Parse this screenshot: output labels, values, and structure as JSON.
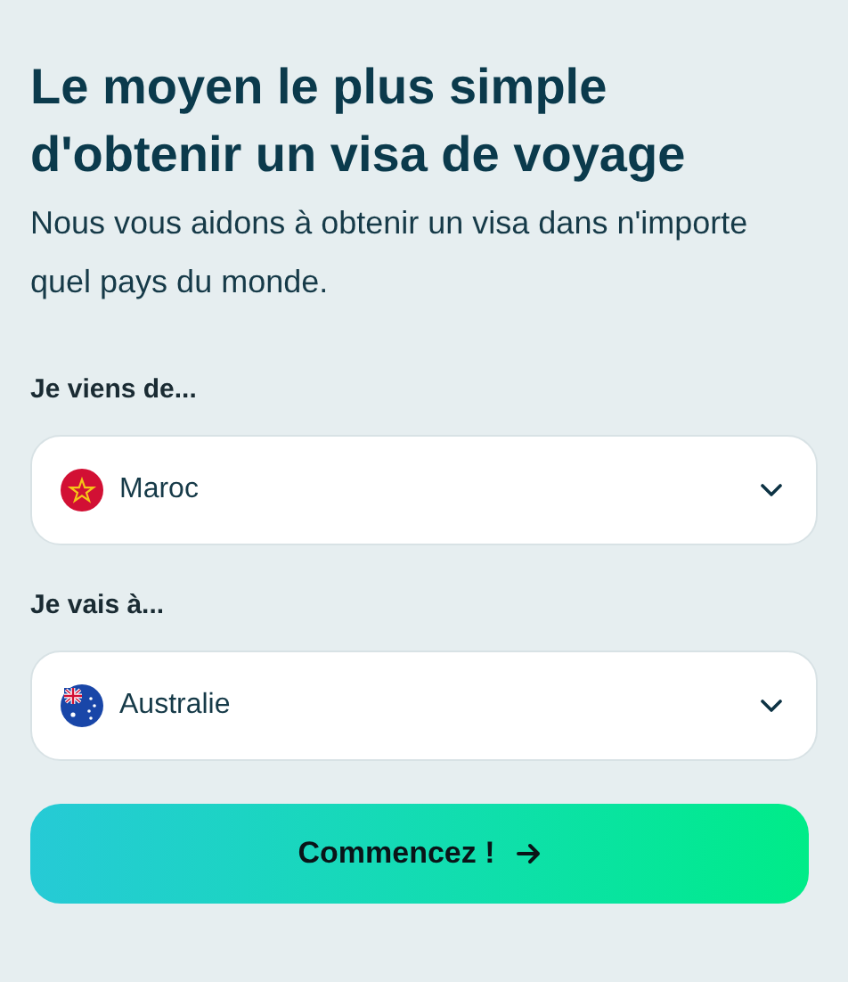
{
  "heading": "Le moyen le plus simple d'obtenir un visa de voyage",
  "subtitle": "Nous vous aidons à obtenir un visa dans n'importe quel pays du monde.",
  "fields": [
    {
      "label": "Je viens de...",
      "value": "Maroc"
    },
    {
      "label": "Je vais à...",
      "value": "Australie"
    }
  ],
  "button": {
    "label": "Commencez !"
  }
}
